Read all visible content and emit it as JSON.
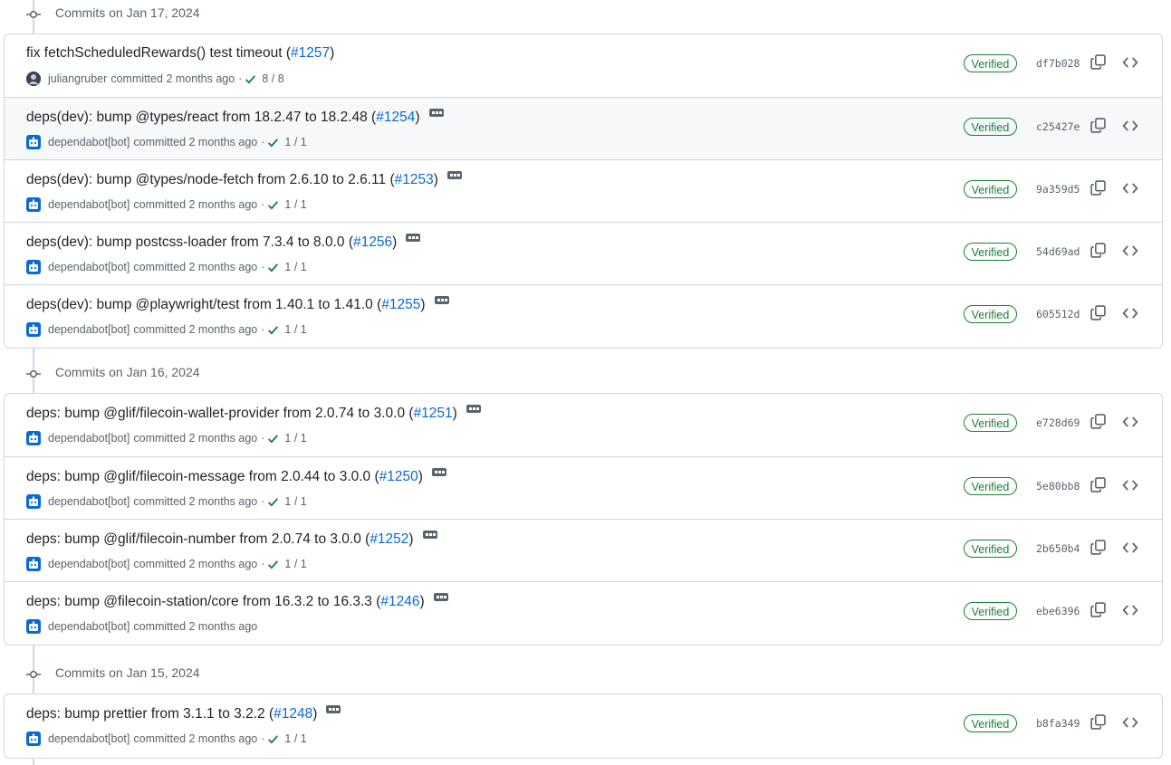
{
  "groups": [
    {
      "title": "Commits on Jan 17, 2024",
      "commits": [
        {
          "message": "fix fetchScheduledRewards() test timeout (",
          "pr": "#1257",
          "suffix": ")",
          "author": "juliangruber",
          "action": "committed 2 months ago",
          "dot": "·",
          "checks": "8 / 8",
          "verified": "Verified",
          "sha": "df7b028",
          "avatar": "human",
          "ellipsis": false,
          "hover": false
        },
        {
          "message": "deps(dev): bump @types/react from 18.2.47 to 18.2.48 (",
          "pr": "#1254",
          "suffix": ")",
          "author": "dependabot[bot]",
          "action": "committed 2 months ago",
          "dot": "·",
          "checks": "1 / 1",
          "verified": "Verified",
          "sha": "c25427e",
          "avatar": "bot",
          "ellipsis": true,
          "hover": true
        },
        {
          "message": "deps(dev): bump @types/node-fetch from 2.6.10 to 2.6.11 (",
          "pr": "#1253",
          "suffix": ")",
          "author": "dependabot[bot]",
          "action": "committed 2 months ago",
          "dot": "·",
          "checks": "1 / 1",
          "verified": "Verified",
          "sha": "9a359d5",
          "avatar": "bot",
          "ellipsis": true,
          "hover": false
        },
        {
          "message": "deps(dev): bump postcss-loader from 7.3.4 to 8.0.0 (",
          "pr": "#1256",
          "suffix": ")",
          "author": "dependabot[bot]",
          "action": "committed 2 months ago",
          "dot": "·",
          "checks": "1 / 1",
          "verified": "Verified",
          "sha": "54d69ad",
          "avatar": "bot",
          "ellipsis": true,
          "hover": false
        },
        {
          "message": "deps(dev): bump @playwright/test from 1.40.1 to 1.41.0 (",
          "pr": "#1255",
          "suffix": ")",
          "author": "dependabot[bot]",
          "action": "committed 2 months ago",
          "dot": "·",
          "checks": "1 / 1",
          "verified": "Verified",
          "sha": "605512d",
          "avatar": "bot",
          "ellipsis": true,
          "hover": false
        }
      ]
    },
    {
      "title": "Commits on Jan 16, 2024",
      "commits": [
        {
          "message": "deps: bump @glif/filecoin-wallet-provider from 2.0.74 to 3.0.0 (",
          "pr": "#1251",
          "suffix": ")",
          "author": "dependabot[bot]",
          "action": "committed 2 months ago",
          "dot": "·",
          "checks": "1 / 1",
          "verified": "Verified",
          "sha": "e728d69",
          "avatar": "bot",
          "ellipsis": true,
          "hover": false
        },
        {
          "message": "deps: bump @glif/filecoin-message from 2.0.44 to 3.0.0 (",
          "pr": "#1250",
          "suffix": ")",
          "author": "dependabot[bot]",
          "action": "committed 2 months ago",
          "dot": "·",
          "checks": "1 / 1",
          "verified": "Verified",
          "sha": "5e80bb8",
          "avatar": "bot",
          "ellipsis": true,
          "hover": false
        },
        {
          "message": "deps: bump @glif/filecoin-number from 2.0.74 to 3.0.0 (",
          "pr": "#1252",
          "suffix": ")",
          "author": "dependabot[bot]",
          "action": "committed 2 months ago",
          "dot": "·",
          "checks": "1 / 1",
          "verified": "Verified",
          "sha": "2b650b4",
          "avatar": "bot",
          "ellipsis": true,
          "hover": false
        },
        {
          "message": "deps: bump @filecoin-station/core from 16.3.2 to 16.3.3 (",
          "pr": "#1246",
          "suffix": ")",
          "author": "dependabot[bot]",
          "action": "committed 2 months ago",
          "dot": "",
          "checks": "",
          "verified": "Verified",
          "sha": "ebe6396",
          "avatar": "bot",
          "ellipsis": true,
          "hover": false
        }
      ]
    },
    {
      "title": "Commits on Jan 15, 2024",
      "commits": [
        {
          "message": "deps: bump prettier from 3.1.1 to 3.2.2 (",
          "pr": "#1248",
          "suffix": ")",
          "author": "dependabot[bot]",
          "action": "committed 2 months ago",
          "dot": "·",
          "checks": "1 / 1",
          "verified": "Verified",
          "sha": "b8fa349",
          "avatar": "bot",
          "ellipsis": true,
          "hover": false
        }
      ]
    }
  ],
  "colors": {
    "link": "#0969da",
    "verified": "#1a7f37",
    "muted": "#59636e",
    "border": "#d0d7de"
  },
  "icons": {
    "timeline": "git-commit-icon",
    "copy": "copy-icon",
    "browse": "code-icon",
    "check": "check-icon",
    "bot": "dependabot-avatar"
  }
}
